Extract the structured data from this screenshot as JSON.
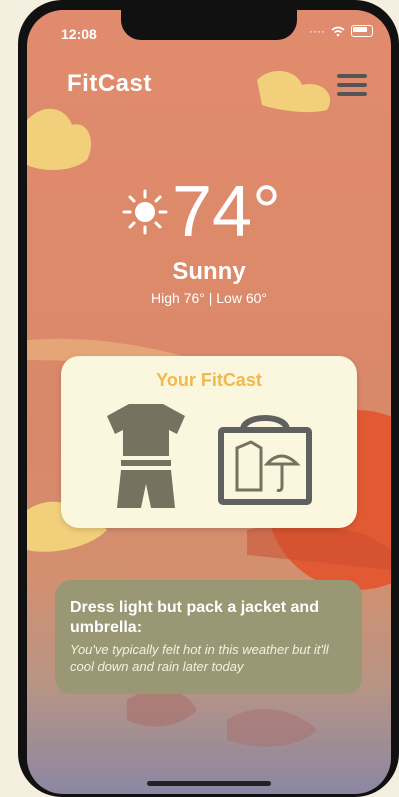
{
  "status_bar": {
    "time": "12:08"
  },
  "app": {
    "logo": "FitCast",
    "menu_icon": "hamburger-menu-icon"
  },
  "weather": {
    "icon": "sun-icon",
    "temperature": "74°",
    "condition": "Sunny",
    "high_low": "High 76° | Low 60°"
  },
  "fitcast_card": {
    "title": "Your FitCast",
    "items": [
      "tshirt-shorts-icon",
      "bag-jacket-umbrella-icon"
    ]
  },
  "advice": {
    "title": "Dress light but pack a jacket and umbrella:",
    "text": "You've typically felt hot in this weather but it'll cool down and rain later today"
  },
  "colors": {
    "accent": "#f0b94a",
    "card_bg": "#fbf7df",
    "advice_bg": "#9a9874",
    "icon_gray": "#76725f"
  }
}
